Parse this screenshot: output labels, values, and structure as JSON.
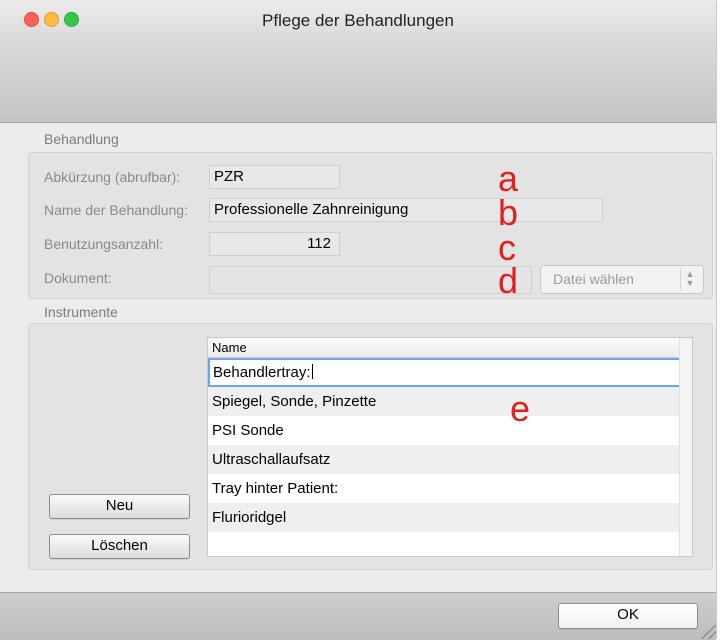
{
  "window": {
    "title": "Pflege der Behandlungen"
  },
  "behandlung": {
    "group_label": "Behandlung",
    "abk_label": "Abkürzung (abrufbar):",
    "abk_value": "PZR",
    "name_label": "Name der Behandlung:",
    "name_value": "Professionelle Zahnreinigung",
    "count_label": "Benutzungsanzahl:",
    "count_value": "112",
    "doc_label": "Dokument:",
    "doc_value": "",
    "file_button": "Datei wählen"
  },
  "annotations": [
    "a",
    "b",
    "c",
    "d",
    "e"
  ],
  "instrumente": {
    "group_label": "Instrumente",
    "new_button": "Neu",
    "delete_button": "Löschen",
    "column_header": "Name",
    "rows": [
      "Behandlertray:",
      "Spiegel, Sonde, Pinzette",
      "PSI Sonde",
      "Ultraschallaufsatz",
      "Tray hinter Patient:",
      "Flurioridgel"
    ]
  },
  "footer": {
    "ok_button": "OK"
  }
}
